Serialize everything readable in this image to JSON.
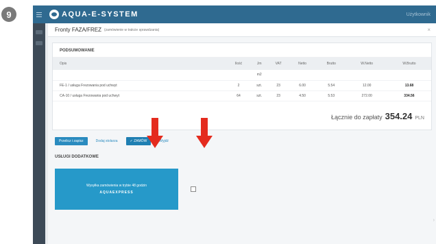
{
  "step_number": "9",
  "app": {
    "title": "AQUA-E-SYSTEM",
    "user": "Użytkownik"
  },
  "page": {
    "title": "Fronty FAZA/FREZ",
    "subtitle": "(zamówienie w trakcie sprawdzania)"
  },
  "summary": {
    "title": "PODSUMOWANIE",
    "headers": [
      "Opis",
      "Ilość",
      "Jm",
      "VAT",
      "Netto",
      "Brutto",
      "W.Netto",
      "W.Brutto"
    ],
    "units_row": [
      "",
      "",
      "m2",
      "",
      "",
      "",
      "",
      ""
    ],
    "rows": [
      {
        "opis": "FE-1 / usługa Frezowania pod uchwyt",
        "ilosc": "2",
        "jm": "szt.",
        "vat": "23",
        "netto": "6.00",
        "brutto": "5.54",
        "w_netto": "12.00",
        "w_brutto": "13.68"
      },
      {
        "opis": "CA-10 / usługa Frezowania pod uchwyt",
        "ilosc": "64",
        "jm": "szt.",
        "vat": "23",
        "netto": "4.50",
        "brutto": "5.53",
        "w_netto": "272.00",
        "w_brutto": "334.56"
      }
    ]
  },
  "total": {
    "label": "Łącznie do zapłaty",
    "amount": "354.24",
    "currency": "PLN"
  },
  "buttons": {
    "przelicz": "Przelicz i zapisz",
    "dodaj": "Dodaj stolarza",
    "zamow": "✓ ZAMÓW",
    "wyjdz": "Wyjdź"
  },
  "services": {
    "title": "USŁUGI DODATKOWE",
    "card_line1": "Wysyłka zamówienia w trybie 48 godzin",
    "card_line2": "AQUAEXPRESS"
  },
  "colors": {
    "topbar": "#2f6a90",
    "accent": "#2a8bbf",
    "arrow": "#e42b1e"
  }
}
